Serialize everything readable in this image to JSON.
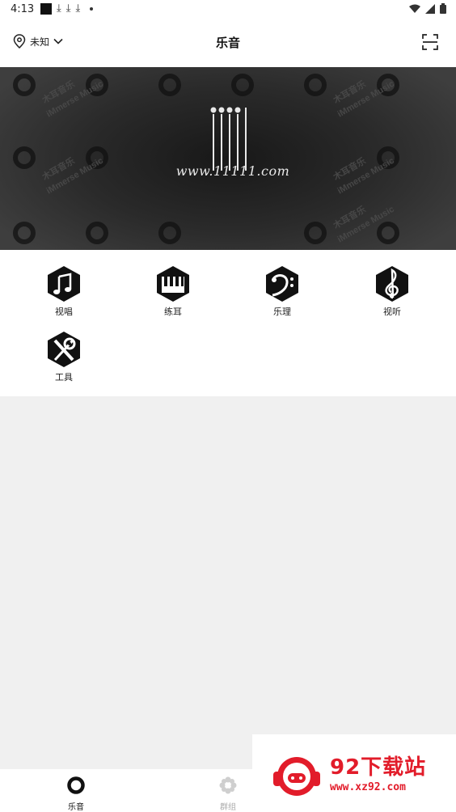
{
  "status_bar": {
    "time": "4:13",
    "left_icons": [
      "notification-square-icon",
      "download-icon",
      "download-icon",
      "download-icon",
      "more-dot-icon"
    ],
    "right_icons": [
      "wifi-icon",
      "signal-icon",
      "battery-icon"
    ]
  },
  "header": {
    "location_label": "未知",
    "title": "乐音",
    "scan_icon": "scan-icon"
  },
  "banner": {
    "url_text": "www.11111.com",
    "pattern_text_1": "木耳音乐",
    "pattern_text_2": "iMmerse Music"
  },
  "categories": [
    {
      "label": "视唱",
      "icon": "music-note-icon"
    },
    {
      "label": "练耳",
      "icon": "piano-keys-icon"
    },
    {
      "label": "乐理",
      "icon": "bass-clef-icon"
    },
    {
      "label": "视听",
      "icon": "treble-clef-icon"
    },
    {
      "label": "工具",
      "icon": "tools-icon"
    }
  ],
  "bottom_nav": [
    {
      "label": "乐音",
      "icon": "ring-logo-icon",
      "active": true
    },
    {
      "label": "群组",
      "icon": "flower-icon",
      "active": false
    }
  ],
  "watermark": {
    "title": "92下载站",
    "url": "www.xz92.com"
  },
  "colors": {
    "accent": "#111111",
    "watermark_red": "#e21c2a",
    "background": "#f0f0f0"
  }
}
